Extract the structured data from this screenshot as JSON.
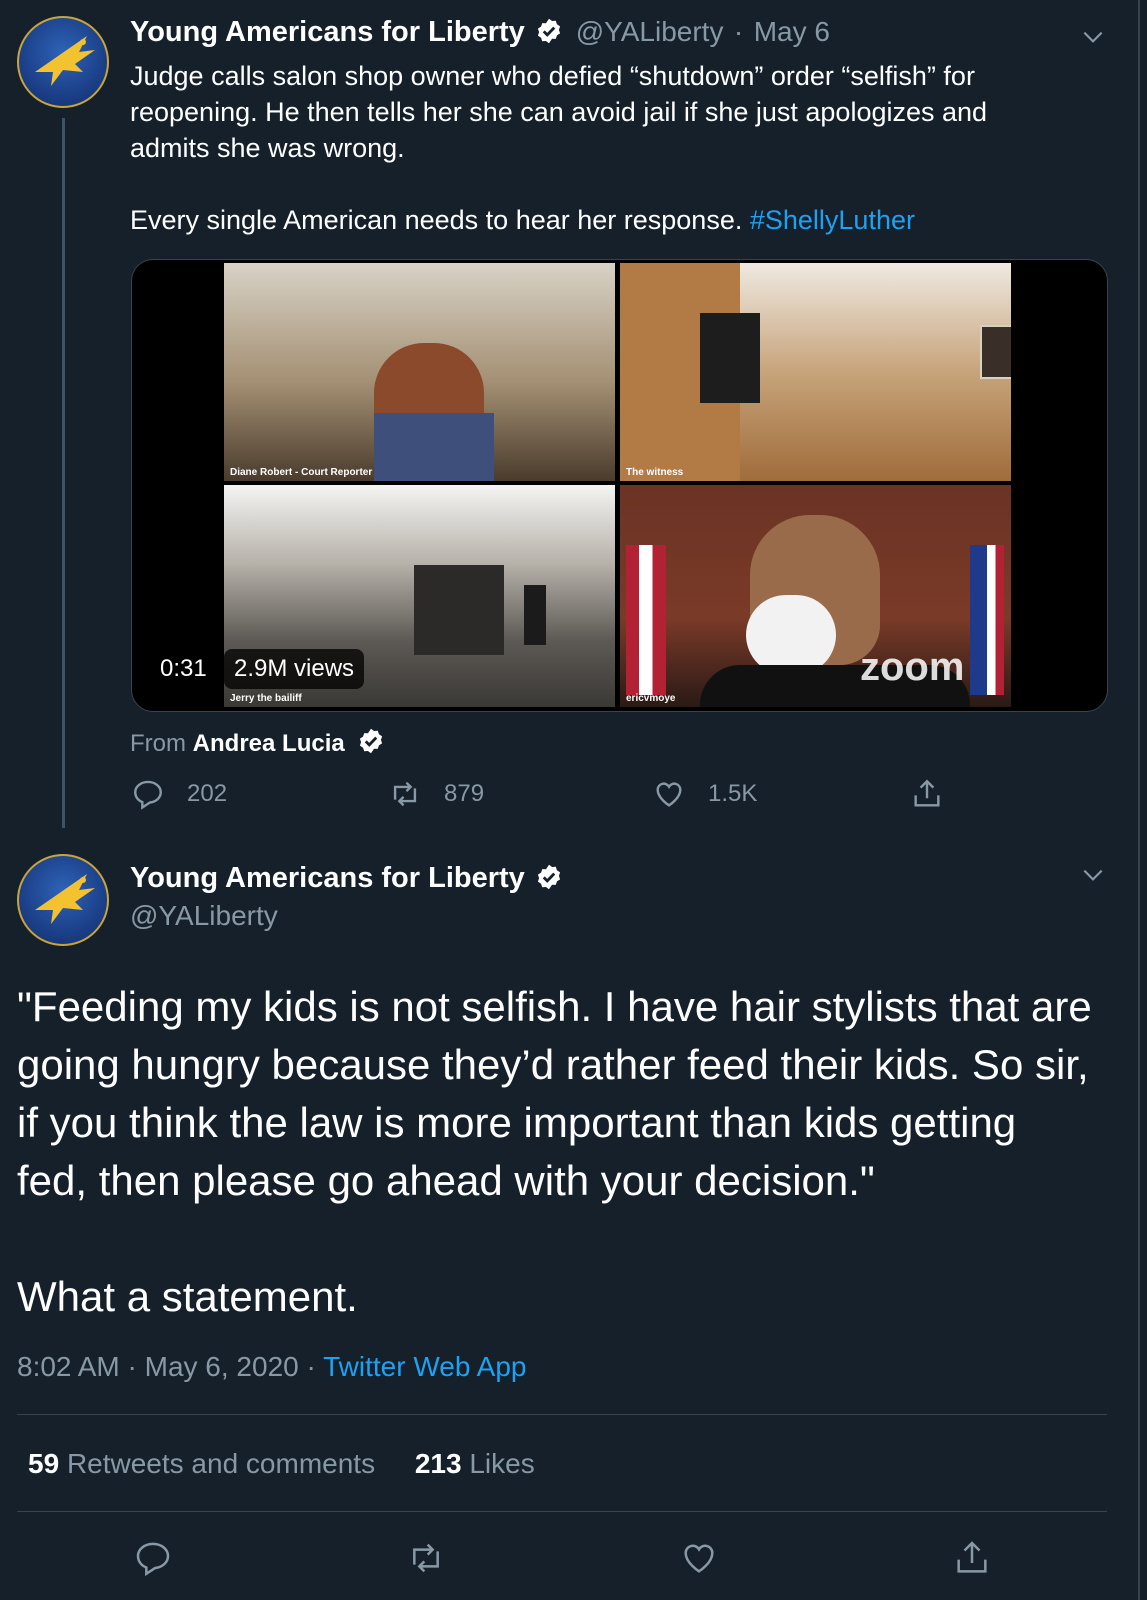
{
  "colors": {
    "background": "#15202b",
    "accent": "#1da1f2",
    "muted": "#8899a6",
    "divider": "#38444d"
  },
  "tweet1": {
    "display_name": "Young Americans for Liberty",
    "handle": "@YALiberty",
    "separator": "·",
    "date": "May 6",
    "text_line1": "Judge calls salon shop owner who defied “shutdown” order “selfish” for",
    "text_line2": "reopening. He then tells her she can avoid jail if she just apologizes and",
    "text_line3": "admits she was wrong.",
    "text_line4": "Every single American needs to hear her response.",
    "hashtag": "#ShellyLuther",
    "media": {
      "duration": "0:31",
      "views": "2.9M views",
      "tiles": [
        {
          "label": "Diane Robert - Court Reporter"
        },
        {
          "label": "The witness"
        },
        {
          "label": "Jerry the bailiff"
        },
        {
          "label": "ericvmoye"
        }
      ],
      "watermark": "zoom"
    },
    "source_prefix": "From",
    "source_name": "Andrea Lucia",
    "actions": {
      "replies": "202",
      "retweets": "879",
      "likes": "1.5K"
    },
    "icons": [
      "reply-icon",
      "retweet-icon",
      "like-icon",
      "share-icon",
      "verified-icon",
      "chevron-down-icon"
    ]
  },
  "tweet2": {
    "display_name": "Young Americans for Liberty",
    "handle": "@YALiberty",
    "text_line1": "\"Feeding my kids is not selfish. I have hair stylists that are",
    "text_line2": "going hungry because they’d rather feed their kids. So sir,",
    "text_line3": "if you think the law is more important than kids getting",
    "text_line4": "fed, then please go ahead with your decision.\"",
    "text_line5": "What a statement.",
    "time": "8:02 AM",
    "separator": "·",
    "date": "May 6, 2020",
    "separator2": "·",
    "client": "Twitter Web App",
    "stats": {
      "retweets_count": "59",
      "retweets_label": "Retweets and comments",
      "likes_count": "213",
      "likes_label": "Likes"
    }
  }
}
